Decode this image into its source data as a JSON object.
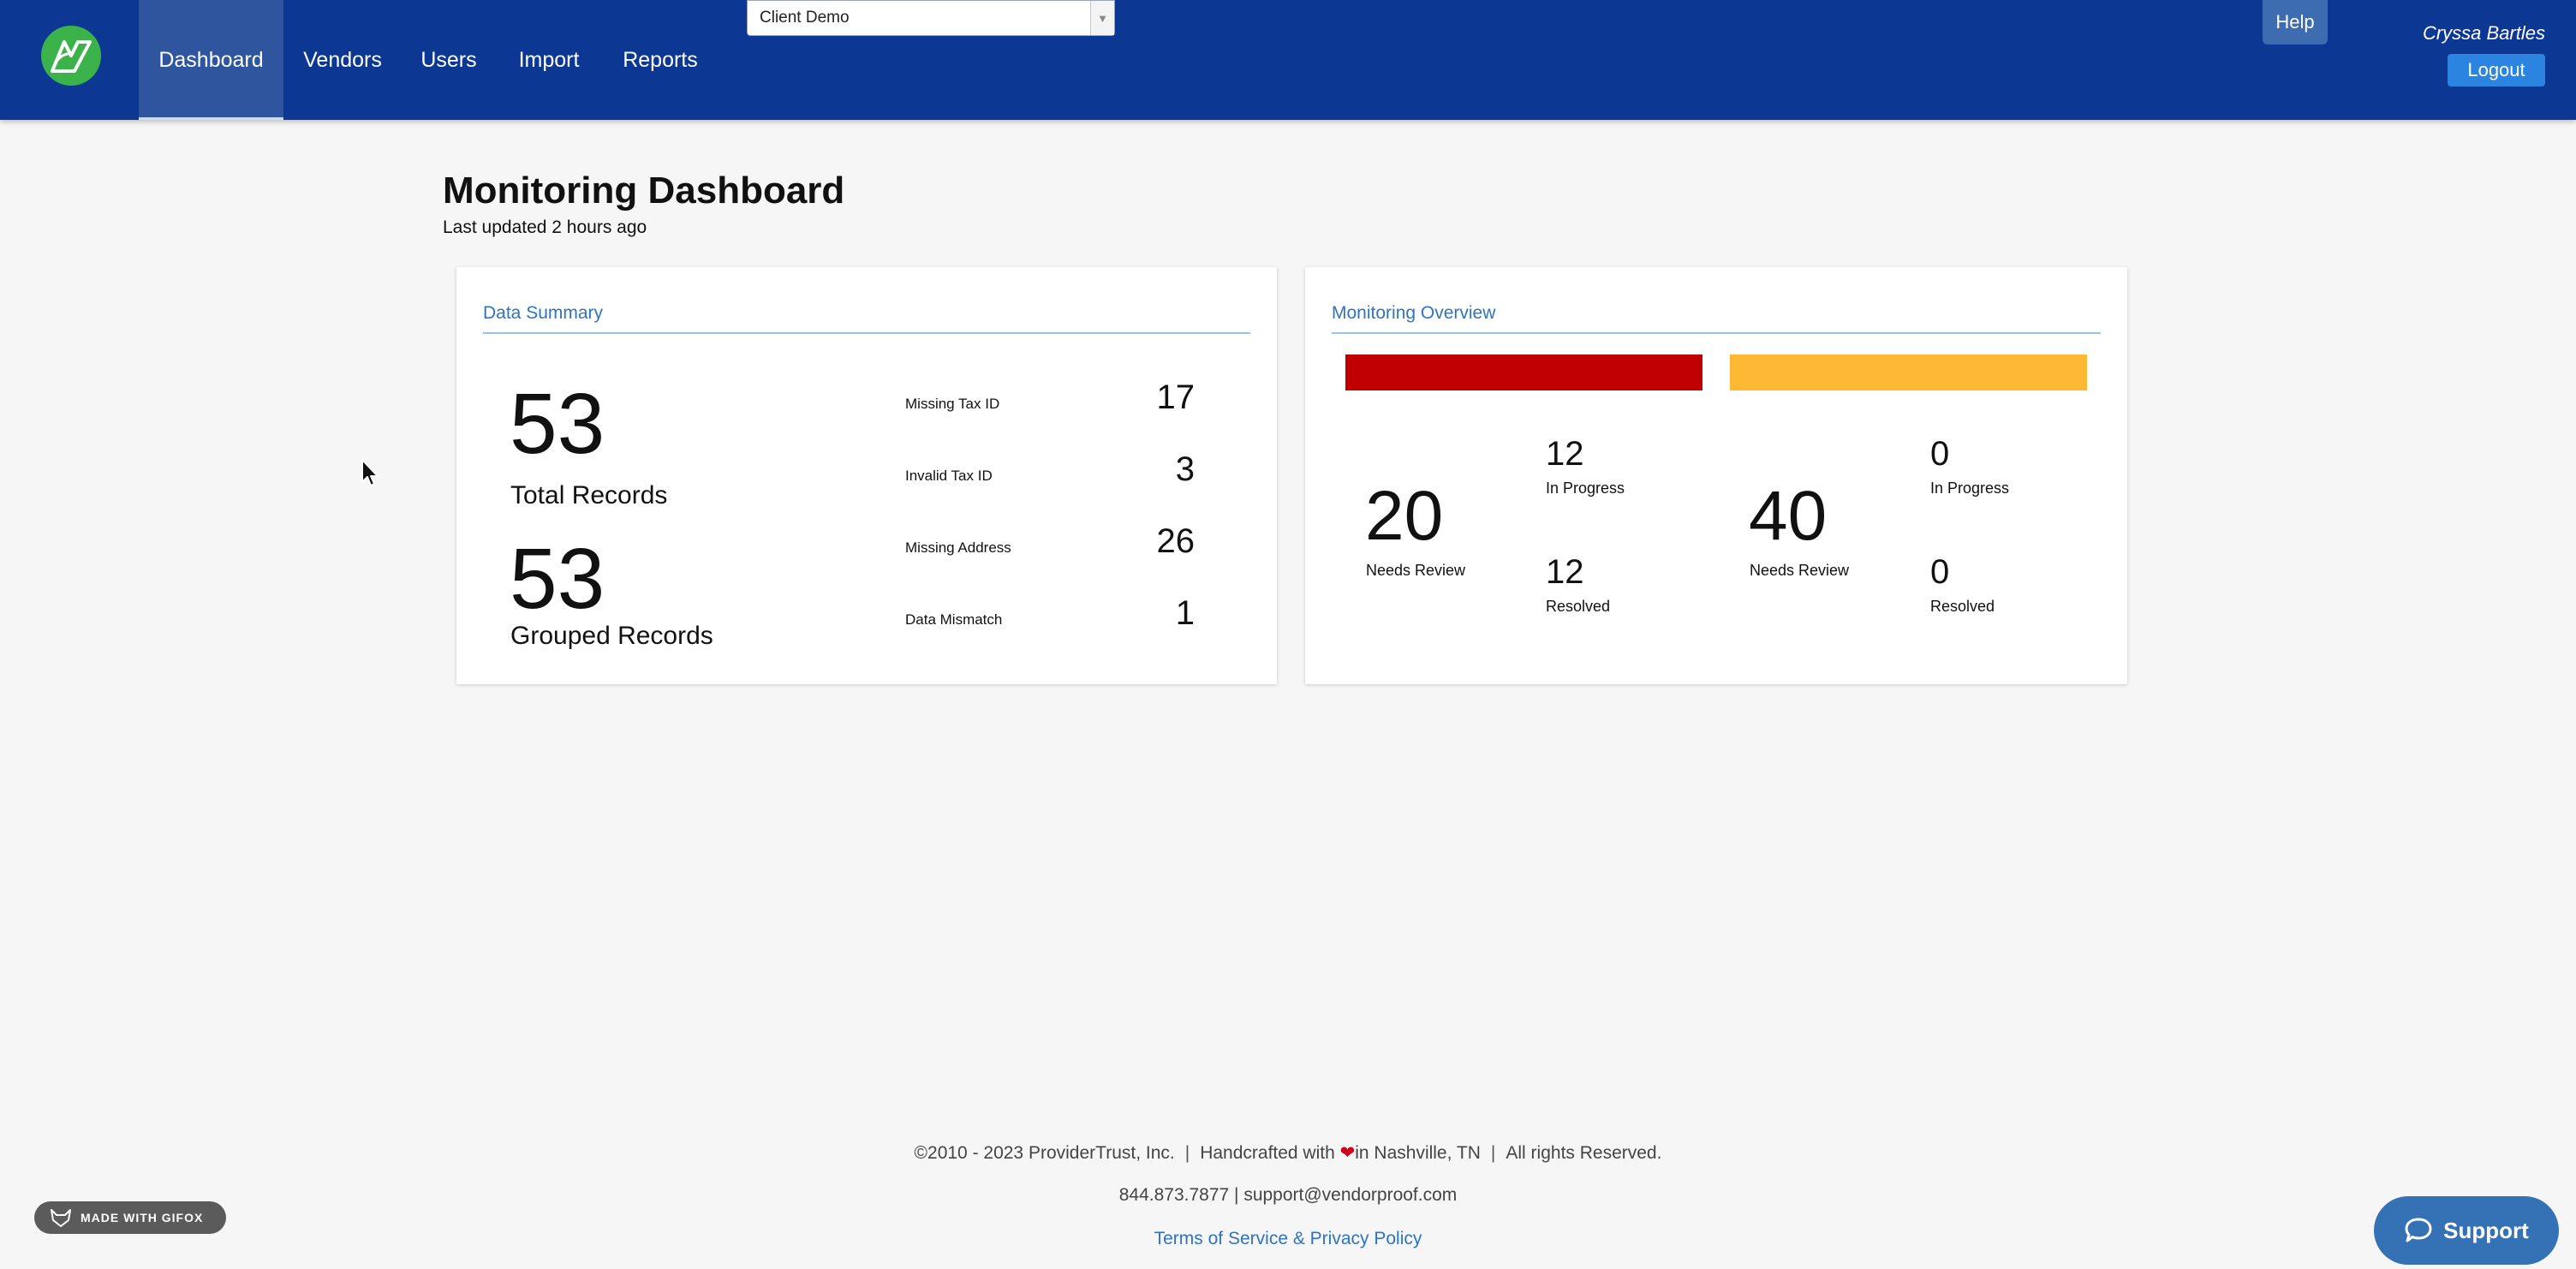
{
  "nav": {
    "items": [
      {
        "label": "Dashboard",
        "active": true
      },
      {
        "label": "Vendors"
      },
      {
        "label": "Users"
      },
      {
        "label": "Import"
      },
      {
        "label": "Reports"
      }
    ],
    "client_select": {
      "value": "Client Demo"
    },
    "help_label": "Help",
    "user_name": "Cryssa Bartles",
    "logout_label": "Logout"
  },
  "page": {
    "title": "Monitoring Dashboard",
    "subtitle": "Last updated 2 hours ago"
  },
  "data_summary": {
    "title": "Data Summary",
    "total_records": {
      "value": "53",
      "label": "Total Records"
    },
    "grouped_records": {
      "value": "53",
      "label": "Grouped Records"
    },
    "stats": [
      {
        "label": "Missing Tax ID",
        "value": "17"
      },
      {
        "label": "Invalid Tax ID",
        "value": "3"
      },
      {
        "label": "Missing Address",
        "value": "26"
      },
      {
        "label": "Data Mismatch",
        "value": "1"
      }
    ]
  },
  "monitoring_overview": {
    "title": "Monitoring Overview",
    "groups": [
      {
        "color": "#c00000",
        "needs_review": {
          "value": "20",
          "label": "Needs Review"
        },
        "in_progress": {
          "value": "12",
          "label": "In Progress"
        },
        "resolved": {
          "value": "12",
          "label": "Resolved"
        }
      },
      {
        "color": "#ffb833",
        "needs_review": {
          "value": "40",
          "label": "Needs Review"
        },
        "in_progress": {
          "value": "0",
          "label": "In Progress"
        },
        "resolved": {
          "value": "0",
          "label": "Resolved"
        }
      }
    ]
  },
  "footer": {
    "copyright": "©2010 - 2023 ProviderTrust, Inc.",
    "handcrafted_before": "Handcrafted with",
    "handcrafted_after": "in Nashville, TN",
    "rights": "All rights Reserved.",
    "contact": "844.873.7877 | support@vendorproof.com",
    "terms": "Terms of Service & Privacy Policy"
  },
  "badges": {
    "gifox": "MADE WITH GIFOX",
    "support": "Support"
  },
  "icons": {
    "logo": "leaf-v-logo-icon",
    "dropdown": "caret-down-icon",
    "heart": "heart-icon",
    "support": "chat-bubble-icon",
    "gifox": "fox-icon",
    "cursor": "mouse-pointer-icon"
  },
  "colors": {
    "nav_bg": "#0c3894",
    "accent": "#2f74c0",
    "danger": "#c00000",
    "warning": "#ffb833"
  }
}
